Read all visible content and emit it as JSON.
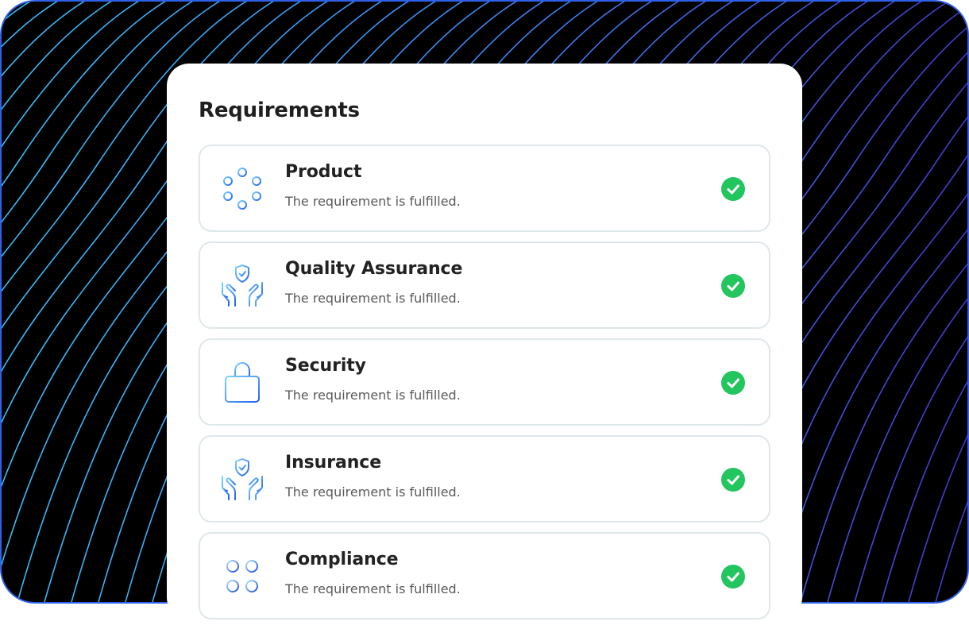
{
  "panel": {
    "title": "Requirements"
  },
  "requirements": [
    {
      "name": "Product",
      "description": "The requirement is fulfilled.",
      "icon": "molecule-dots-icon",
      "status": "fulfilled"
    },
    {
      "name": "Quality Assurance",
      "description": "The requirement is fulfilled.",
      "icon": "hands-shield-icon",
      "status": "fulfilled"
    },
    {
      "name": "Security",
      "description": "The requirement is fulfilled.",
      "icon": "padlock-icon",
      "status": "fulfilled"
    },
    {
      "name": "Insurance",
      "description": "The requirement is fulfilled.",
      "icon": "hands-shield-icon",
      "status": "fulfilled"
    },
    {
      "name": "Compliance",
      "description": "The requirement is fulfilled.",
      "icon": "four-circles-icon",
      "status": "fulfilled"
    }
  ],
  "colors": {
    "background": "#000000",
    "wave_line_start": "#38bdf8",
    "wave_line_end": "#3b4fe0",
    "status_success": "#22c55e",
    "icon_gradient_start": "#7dd3fc",
    "icon_gradient_end": "#2563eb"
  }
}
